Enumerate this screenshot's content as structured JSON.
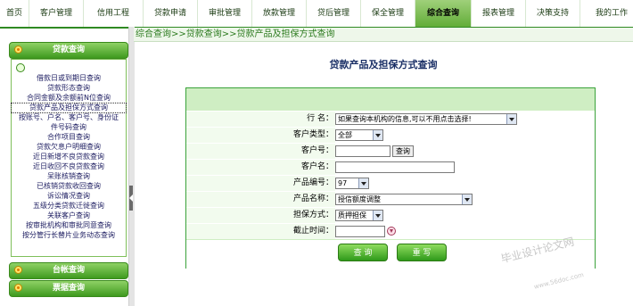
{
  "topnav": {
    "items": [
      "首页",
      "客户管理",
      "信用工程",
      "贷款申请",
      "审批管理",
      "放款管理",
      "贷后管理",
      "保全管理",
      "综合查询",
      "报表管理",
      "决策支持",
      "我的工作"
    ],
    "active_index": 8
  },
  "sidebar": {
    "sections": [
      "贷款查询",
      "台帐查询",
      "票据查询"
    ],
    "links": [
      "借款日或到期日查询",
      "贷款形态查询",
      "合同金额及余额前N位查询",
      "贷款产品及担保方式查询",
      "按账号、户名、客户号、身份证",
      "件号码查询",
      "合作项目查询",
      "贷款欠息户明细查询",
      "近日新增不良贷款查询",
      "近日收回不良贷款查询",
      "呆账核销查询",
      "已核销贷款收回查询",
      "诉讼情况查询",
      "五级分类贷款迁徙查询",
      "关联客户查询",
      "按审批机构和审批同意查询",
      "按分管行长替片业务动态查询"
    ],
    "selected_link_index": 3
  },
  "breadcrumb": "综合查询>>贷款查询>>贷款产品及担保方式查询",
  "page_title": "贷款产品及担保方式查询",
  "form": {
    "branch_label": "行   名：",
    "branch_value": "如果查询本机构的信息,可以不用点击选择!",
    "customer_type_label": "客户类型：",
    "customer_type_value": "全部",
    "customer_no_label": "客户号：",
    "customer_no_value": "",
    "query_small_label": "查询",
    "customer_name_label": "客户名：",
    "customer_name_value": "",
    "product_code_label": "产品编号：",
    "product_code_value": "97",
    "product_name_label": "产品名称：",
    "product_name_value": "授信额度调整",
    "guarantee_label": "担保方式：",
    "guarantee_value": "质押担保",
    "deadline_label": "截止时间：",
    "deadline_value": "",
    "query_button": "查  询",
    "reset_button": "重  写"
  },
  "watermark": {
    "text": "毕业设计论文网",
    "url": "www.56doc.com"
  }
}
